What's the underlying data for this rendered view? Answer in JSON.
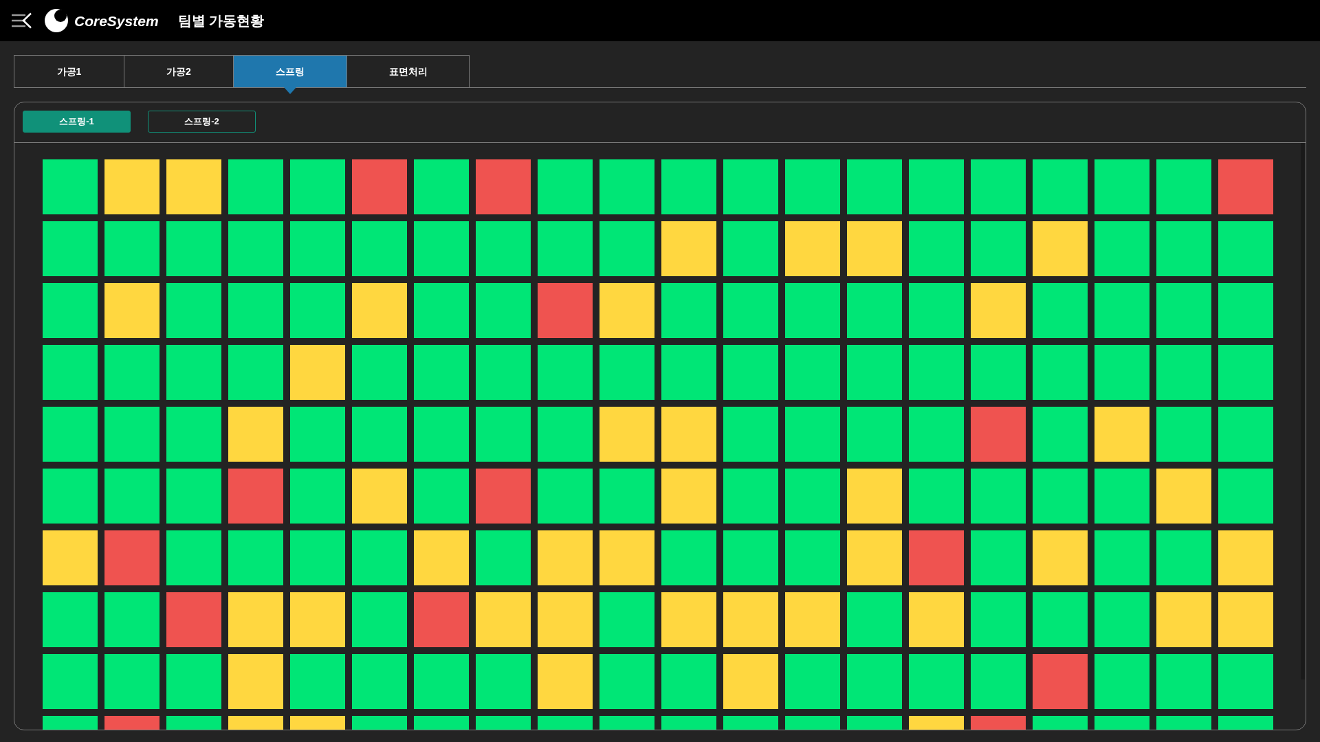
{
  "header": {
    "logo_text": "CoreSystem",
    "title": "팀별 가동현황"
  },
  "tabs": [
    {
      "label": "가공1",
      "selected": false
    },
    {
      "label": "가공2",
      "selected": false
    },
    {
      "label": "스프링",
      "selected": true
    },
    {
      "label": "표면처리",
      "selected": false
    }
  ],
  "sub_tabs": [
    {
      "label": "스프링-1",
      "selected": true
    },
    {
      "label": "스프링-2",
      "selected": false
    }
  ],
  "grid": {
    "rows": [
      [
        {
          "color": "#00e676"
        },
        {
          "color": "#ffd740"
        },
        {
          "color": "#ffd740"
        },
        {
          "color": "#00e676"
        },
        {
          "color": "#00e676"
        },
        {
          "color": "#ef5350"
        },
        {
          "color": "#00e676"
        },
        {
          "color": "#ef5350"
        },
        {
          "color": "#00e676"
        },
        {
          "color": "#00e676"
        },
        {
          "color": "#00e676"
        },
        {
          "color": "#00e676"
        },
        {
          "color": "#00e676"
        },
        {
          "color": "#00e676"
        },
        {
          "color": "#00e676"
        },
        {
          "color": "#00e676"
        },
        {
          "color": "#00e676"
        },
        {
          "color": "#00e676"
        },
        {
          "color": "#00e676"
        },
        {
          "color": "#ef5350"
        }
      ],
      [
        {
          "color": "#00e676"
        },
        {
          "color": "#00e676"
        },
        {
          "color": "#00e676"
        },
        {
          "color": "#00e676"
        },
        {
          "color": "#00e676"
        },
        {
          "color": "#00e676"
        },
        {
          "color": "#00e676"
        },
        {
          "color": "#00e676"
        },
        {
          "color": "#00e676"
        },
        {
          "color": "#00e676"
        },
        {
          "color": "#ffd740"
        },
        {
          "color": "#00e676"
        },
        {
          "color": "#ffd740"
        },
        {
          "color": "#ffd740"
        },
        {
          "color": "#00e676"
        },
        {
          "color": "#00e676"
        },
        {
          "color": "#ffd740"
        },
        {
          "color": "#00e676"
        },
        {
          "color": "#00e676"
        },
        {
          "color": "#00e676"
        }
      ],
      [
        {
          "color": "#00e676"
        },
        {
          "color": "#ffd740"
        },
        {
          "color": "#00e676"
        },
        {
          "color": "#00e676"
        },
        {
          "color": "#00e676"
        },
        {
          "color": "#ffd740"
        },
        {
          "color": "#00e676"
        },
        {
          "color": "#00e676"
        },
        {
          "color": "#ef5350"
        },
        {
          "color": "#ffd740"
        },
        {
          "color": "#00e676"
        },
        {
          "color": "#00e676"
        },
        {
          "color": "#00e676"
        },
        {
          "color": "#00e676"
        },
        {
          "color": "#00e676"
        },
        {
          "color": "#ffd740"
        },
        {
          "color": "#00e676"
        },
        {
          "color": "#00e676"
        },
        {
          "color": "#00e676"
        },
        {
          "color": "#00e676"
        }
      ],
      [
        {
          "color": "#00e676"
        },
        {
          "color": "#00e676"
        },
        {
          "color": "#00e676"
        },
        {
          "color": "#00e676"
        },
        {
          "color": "#ffd740"
        },
        {
          "color": "#00e676"
        },
        {
          "color": "#00e676"
        },
        {
          "color": "#00e676"
        },
        {
          "color": "#00e676"
        },
        {
          "color": "#00e676"
        },
        {
          "color": "#00e676"
        },
        {
          "color": "#00e676"
        },
        {
          "color": "#00e676"
        },
        {
          "color": "#00e676"
        },
        {
          "color": "#00e676"
        },
        {
          "color": "#00e676"
        },
        {
          "color": "#00e676"
        },
        {
          "color": "#00e676"
        },
        {
          "color": "#00e676"
        },
        {
          "color": "#00e676"
        }
      ],
      [
        {
          "color": "#00e676"
        },
        {
          "color": "#00e676"
        },
        {
          "color": "#00e676"
        },
        {
          "color": "#ffd740"
        },
        {
          "color": "#00e676"
        },
        {
          "color": "#00e676"
        },
        {
          "color": "#00e676"
        },
        {
          "color": "#00e676"
        },
        {
          "color": "#00e676"
        },
        {
          "color": "#ffd740"
        },
        {
          "color": "#ffd740"
        },
        {
          "color": "#00e676"
        },
        {
          "color": "#00e676"
        },
        {
          "color": "#00e676"
        },
        {
          "color": "#00e676"
        },
        {
          "color": "#ef5350"
        },
        {
          "color": "#00e676"
        },
        {
          "color": "#ffd740"
        },
        {
          "color": "#00e676"
        },
        {
          "color": "#00e676"
        }
      ],
      [
        {
          "color": "#00e676"
        },
        {
          "color": "#00e676"
        },
        {
          "color": "#00e676"
        },
        {
          "color": "#ef5350"
        },
        {
          "color": "#00e676"
        },
        {
          "color": "#ffd740"
        },
        {
          "color": "#00e676"
        },
        {
          "color": "#ef5350"
        },
        {
          "color": "#00e676"
        },
        {
          "color": "#00e676"
        },
        {
          "color": "#ffd740"
        },
        {
          "color": "#00e676"
        },
        {
          "color": "#00e676"
        },
        {
          "color": "#ffd740"
        },
        {
          "color": "#00e676"
        },
        {
          "color": "#00e676"
        },
        {
          "color": "#00e676"
        },
        {
          "color": "#00e676"
        },
        {
          "color": "#ffd740"
        },
        {
          "color": "#00e676"
        }
      ],
      [
        {
          "color": "#ffd740"
        },
        {
          "color": "#ef5350"
        },
        {
          "color": "#00e676"
        },
        {
          "color": "#00e676"
        },
        {
          "color": "#00e676"
        },
        {
          "color": "#00e676"
        },
        {
          "color": "#ffd740"
        },
        {
          "color": "#00e676"
        },
        {
          "color": "#ffd740"
        },
        {
          "color": "#ffd740"
        },
        {
          "color": "#00e676"
        },
        {
          "color": "#00e676"
        },
        {
          "color": "#00e676"
        },
        {
          "color": "#ffd740"
        },
        {
          "color": "#ef5350"
        },
        {
          "color": "#00e676"
        },
        {
          "color": "#ffd740"
        },
        {
          "color": "#00e676"
        },
        {
          "color": "#00e676"
        },
        {
          "color": "#ffd740"
        }
      ],
      [
        {
          "color": "#00e676"
        },
        {
          "color": "#00e676"
        },
        {
          "color": "#ef5350"
        },
        {
          "color": "#ffd740"
        },
        {
          "color": "#ffd740"
        },
        {
          "color": "#00e676"
        },
        {
          "color": "#ef5350"
        },
        {
          "color": "#ffd740"
        },
        {
          "color": "#ffd740"
        },
        {
          "color": "#00e676"
        },
        {
          "color": "#ffd740"
        },
        {
          "color": "#ffd740"
        },
        {
          "color": "#ffd740"
        },
        {
          "color": "#00e676"
        },
        {
          "color": "#ffd740"
        },
        {
          "color": "#00e676"
        },
        {
          "color": "#00e676"
        },
        {
          "color": "#00e676"
        },
        {
          "color": "#ffd740"
        },
        {
          "color": "#ffd740"
        }
      ],
      [
        {
          "color": "#00e676"
        },
        {
          "color": "#00e676"
        },
        {
          "color": "#00e676"
        },
        {
          "color": "#ffd740"
        },
        {
          "color": "#00e676"
        },
        {
          "color": "#00e676"
        },
        {
          "color": "#00e676"
        },
        {
          "color": "#00e676"
        },
        {
          "color": "#ffd740"
        },
        {
          "color": "#00e676"
        },
        {
          "color": "#00e676"
        },
        {
          "color": "#ffd740"
        },
        {
          "color": "#00e676"
        },
        {
          "color": "#00e676"
        },
        {
          "color": "#00e676"
        },
        {
          "color": "#00e676"
        },
        {
          "color": "#ef5350"
        },
        {
          "color": "#00e676"
        },
        {
          "color": "#00e676"
        },
        {
          "color": "#00e676"
        }
      ],
      [
        {
          "color": "#00e676"
        },
        {
          "color": "#ef5350"
        },
        {
          "color": "#00e676"
        },
        {
          "color": "#ffd740"
        },
        {
          "color": "#ffd740"
        },
        {
          "color": "#00e676"
        },
        {
          "color": "#00e676"
        },
        {
          "color": "#00e676"
        },
        {
          "color": "#00e676"
        },
        {
          "color": "#00e676"
        },
        {
          "color": "#00e676"
        },
        {
          "color": "#00e676"
        },
        {
          "color": "#00e676"
        },
        {
          "color": "#00e676"
        },
        {
          "color": "#ffd740"
        },
        {
          "color": "#ef5350"
        },
        {
          "color": "#00e676"
        },
        {
          "color": "#00e676"
        },
        {
          "color": "#00e676"
        },
        {
          "color": "#00e676"
        }
      ]
    ]
  }
}
